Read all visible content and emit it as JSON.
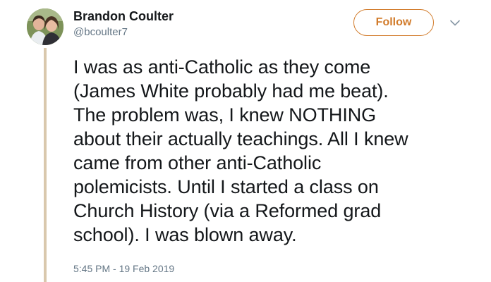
{
  "author": {
    "display_name": "Brandon Coulter",
    "handle": "@bcoulter7"
  },
  "actions": {
    "follow_label": "Follow",
    "more_icon": "chevron-down-icon"
  },
  "tweet": {
    "lines": [
      "I was as anti-Catholic as they come",
      "(James White probably had me beat).",
      "The problem was, I knew NOTHING",
      "about their actually teachings. All I knew",
      "came from other anti-Catholic",
      "polemicists. Until I started a class on",
      "Church History (via a Reformed grad",
      "school). I was blown away."
    ],
    "timestamp": "5:45 PM - 19 Feb 2019"
  },
  "colors": {
    "accent": "#d27c2c",
    "thread_line": "#d9c8ad",
    "secondary_text": "#657786",
    "primary_text": "#14171a"
  }
}
